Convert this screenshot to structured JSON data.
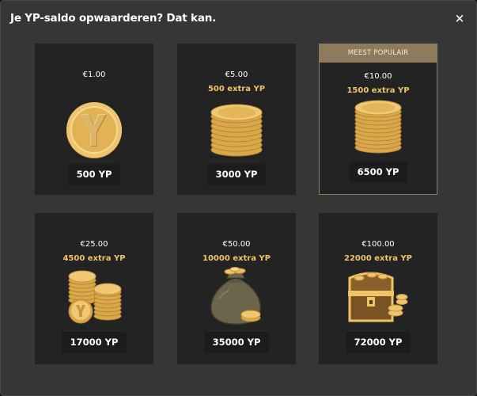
{
  "dialog": {
    "title": "Je YP-saldo opwaarderen? Dat kan.",
    "close_label": "×"
  },
  "packages": [
    {
      "price": "€1.00",
      "extra": "",
      "amount": "500 YP",
      "art": "single-coin"
    },
    {
      "price": "€5.00",
      "extra": "500 extra YP",
      "amount": "3000 YP",
      "art": "coin-stack"
    },
    {
      "price": "€10.00",
      "extra": "1500 extra YP",
      "amount": "6500 YP",
      "art": "tall-coin-stack",
      "badge": "MEEST POPULAIR"
    },
    {
      "price": "€25.00",
      "extra": "4500 extra YP",
      "amount": "17000 YP",
      "art": "coin-piles"
    },
    {
      "price": "€50.00",
      "extra": "10000 extra YP",
      "amount": "35000 YP",
      "art": "coin-sack"
    },
    {
      "price": "€100.00",
      "extra": "22000 extra YP",
      "amount": "72000 YP",
      "art": "treasure-chest"
    }
  ],
  "colors": {
    "modal_bg": "#363636",
    "card_bg": "#232323",
    "accent_gold": "#f0c466",
    "featured_border": "#8d7b5b"
  }
}
